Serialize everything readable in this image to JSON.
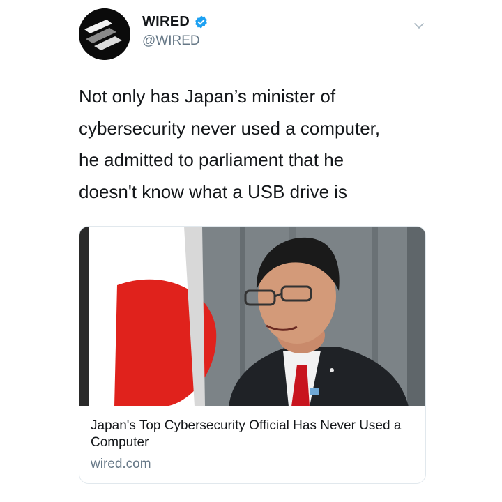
{
  "tweet": {
    "author": {
      "name": "WIRED",
      "handle": "@WIRED",
      "verified": true,
      "avatar_icon": "wired-logo-icon"
    },
    "menu_icon": "chevron-down-icon",
    "text": "Not only has Japan’s minister of\ncybersecurity never used a computer,\nhe admitted to parliament that he\ndoesn't know what a USB drive is",
    "card": {
      "image_icon": "article-photo",
      "title": "Japan's Top Cybersecurity Official Has Never Used a Computer",
      "domain": "wired.com"
    }
  },
  "colors": {
    "text_primary": "#14171a",
    "text_secondary": "#657786",
    "verified_blue": "#1da1f2",
    "card_border": "#e1e8ed",
    "flag_red": "#e0221c"
  }
}
